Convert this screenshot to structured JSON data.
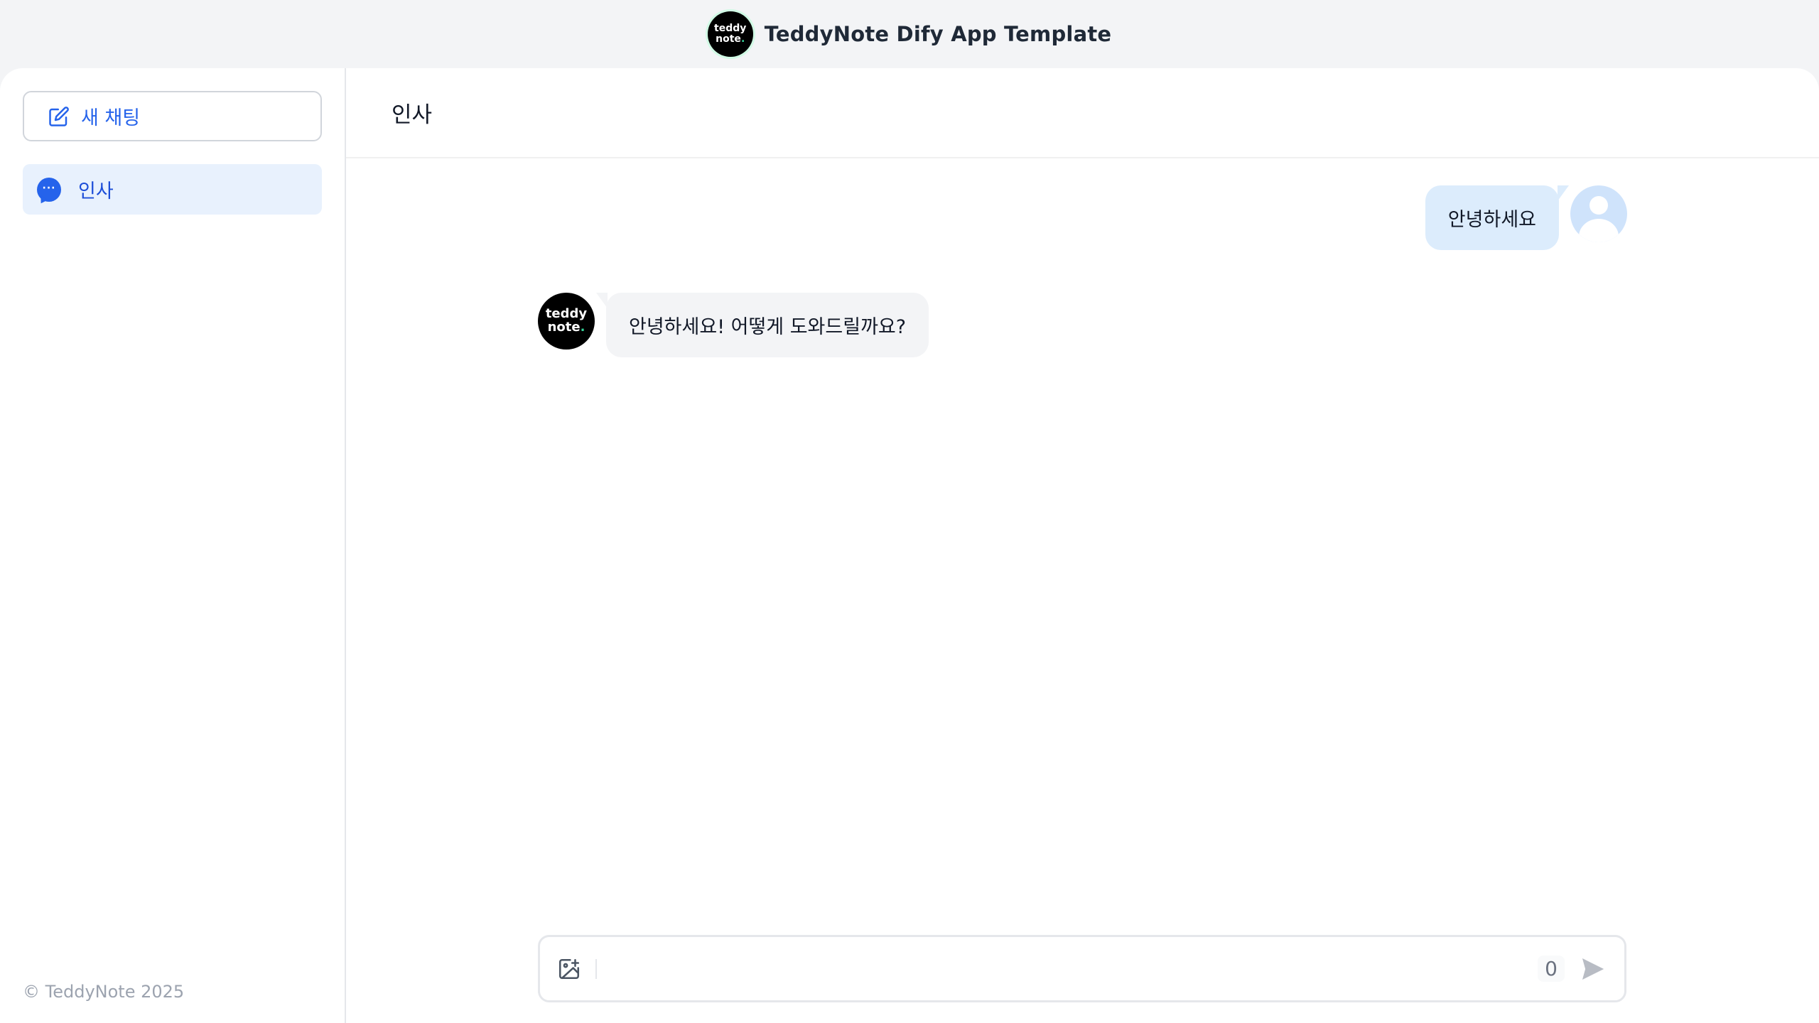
{
  "app": {
    "title": "TeddyNote Dify App Template",
    "logo_line1": "teddy",
    "logo_line2": "note",
    "logo_dot": "."
  },
  "sidebar": {
    "new_chat_label": "새 채팅",
    "conversations": [
      {
        "label": "인사",
        "active": true
      }
    ],
    "footer": "© TeddyNote 2025"
  },
  "chat": {
    "title": "인사",
    "messages": [
      {
        "role": "user",
        "text": "안녕하세요"
      },
      {
        "role": "assistant",
        "text": "안녕하세요! 어떻게 도와드릴까요?"
      }
    ]
  },
  "composer": {
    "value": "",
    "char_count": "0"
  },
  "colors": {
    "accent": "#2563eb",
    "user_bubble": "#dcecfc",
    "bot_bubble": "#f3f4f6",
    "active_item": "#e8f1fd"
  }
}
